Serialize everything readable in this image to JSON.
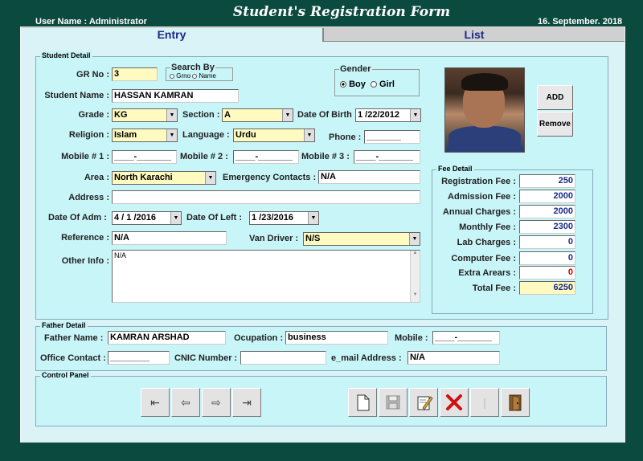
{
  "header": {
    "user_name": "User Name :  Administrator",
    "title": "Student's Registration Form",
    "date": "16. September. 2018"
  },
  "tabs": {
    "entry": "Entry",
    "list": "List"
  },
  "student": {
    "legend": "Student Detail",
    "gr_label": "GR No :",
    "gr_value": "3",
    "search_by_label": "Search By",
    "search_grno": "Grno",
    "search_name": "Name",
    "gender_label": "Gender",
    "gender_boy": "Boy",
    "gender_girl": "Girl",
    "name_label": "Student Name :",
    "name_value": "HASSAN KAMRAN",
    "grade_label": "Grade :",
    "grade_value": "KG",
    "section_label": "Section :",
    "section_value": "A",
    "dob_label": "Date Of Birth",
    "dob_value": "1 /22/2012",
    "religion_label": "Religion :",
    "religion_value": "Islam",
    "language_label": "Language :",
    "language_value": "Urdu",
    "phone_label": "Phone :",
    "phone_value": "_______",
    "mobile1_label": "Mobile # 1 :",
    "mobile1_value": "____-_______",
    "mobile2_label": "Mobile # 2 :",
    "mobile2_value": "____-_______",
    "mobile3_label": "Mobile # 3 :",
    "mobile3_value": "____-_______",
    "area_label": "Area :",
    "area_value": "North Karachi",
    "emergency_label": "Emergency Contacts :",
    "emergency_value": "N/A",
    "address_label": "Address :",
    "address_value": "",
    "adm_label": "Date Of Adm :",
    "adm_value": "4 / 1 /2016",
    "left_label": "Date Of Left :",
    "left_value": "1 /23/2016",
    "reference_label": "Reference :",
    "reference_value": "N/A",
    "van_label": "Van Driver :",
    "van_value": "N/S",
    "other_label": "Other Info :",
    "other_value": "N/A",
    "add_button": "ADD",
    "remove_button": "Remove"
  },
  "fee": {
    "legend": "Fee Detail",
    "rows": [
      {
        "label": "Registration Fee :",
        "value": "250"
      },
      {
        "label": "Admission Fee :",
        "value": "2000"
      },
      {
        "label": "Annual Charges :",
        "value": "2000"
      },
      {
        "label": "Monthly Fee :",
        "value": "2300"
      },
      {
        "label": "Lab Charges :",
        "value": "0"
      },
      {
        "label": "Computer Fee :",
        "value": "0"
      },
      {
        "label": "Extra Arears :",
        "value": "0"
      },
      {
        "label": "Total Fee :",
        "value": "6250"
      }
    ]
  },
  "father": {
    "legend": "Father Detail",
    "name_label": "Father Name :",
    "name_value": "KAMRAN ARSHAD",
    "occupation_label": "Ocupation :",
    "occupation_value": "business",
    "mobile_label": "Mobile :",
    "mobile_value": "____-_______",
    "office_label": "Office Contact :",
    "office_value": "________",
    "cnic_label": "CNIC Number :",
    "cnic_value": "",
    "email_label": "e_mail Address :",
    "email_value": "N/A"
  },
  "control": {
    "legend": "Control Panel",
    "icons": [
      "first-record-icon",
      "previous-record-icon",
      "next-record-icon",
      "last-record-icon",
      "new-icon",
      "save-icon",
      "edit-icon",
      "delete-icon",
      "blank-button",
      "exit-icon"
    ]
  },
  "colors": {
    "background": "#0b4a3f",
    "panel": "#c8f5f8",
    "input_yellow": "#fffac0",
    "title_blue": "#1a2a8a"
  }
}
